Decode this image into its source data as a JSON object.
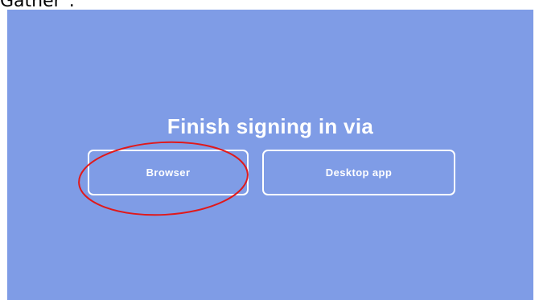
{
  "caption": "Gather\".",
  "heading": "Finish signing in via",
  "buttons": {
    "browser": "Browser",
    "desktop": "Desktop app"
  },
  "colors": {
    "panel_background": "#7f9ce6",
    "button_border": "#ffffff",
    "text": "#ffffff",
    "annotation_ring": "#e0191b"
  }
}
